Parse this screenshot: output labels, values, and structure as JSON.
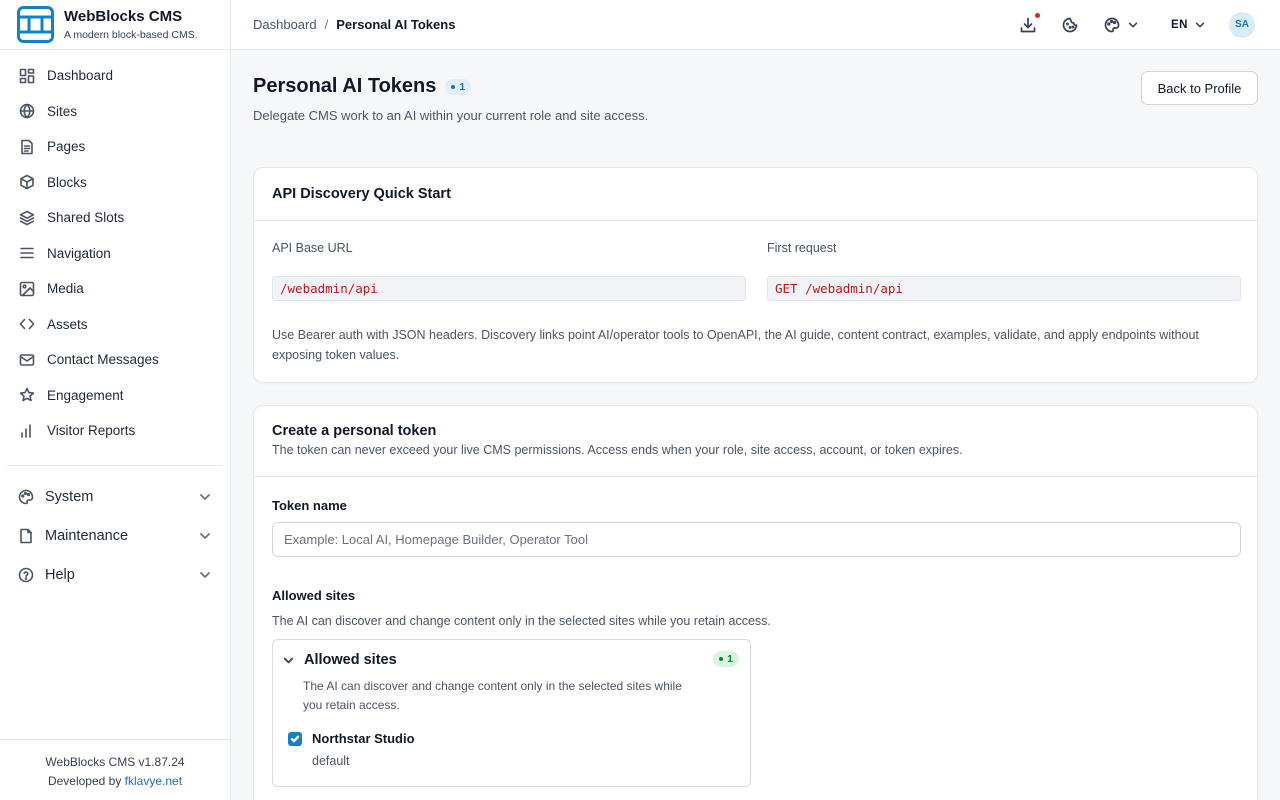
{
  "brand": {
    "name": "WebBlocks CMS",
    "tagline": "A modern block-based CMS."
  },
  "sidebar": {
    "items": [
      {
        "label": "Dashboard",
        "icon": "dashboard-icon"
      },
      {
        "label": "Sites",
        "icon": "globe-icon"
      },
      {
        "label": "Pages",
        "icon": "file-icon"
      },
      {
        "label": "Blocks",
        "icon": "cube-icon"
      },
      {
        "label": "Shared Slots",
        "icon": "layers-icon"
      },
      {
        "label": "Navigation",
        "icon": "menu-icon"
      },
      {
        "label": "Media",
        "icon": "image-icon"
      },
      {
        "label": "Assets",
        "icon": "code-icon"
      },
      {
        "label": "Contact Messages",
        "icon": "mail-icon"
      },
      {
        "label": "Engagement",
        "icon": "star-icon"
      },
      {
        "label": "Visitor Reports",
        "icon": "bar-chart-icon"
      }
    ],
    "groups": [
      {
        "label": "System",
        "icon": "palette-icon"
      },
      {
        "label": "Maintenance",
        "icon": "document-icon"
      },
      {
        "label": "Help",
        "icon": "help-circle-icon"
      }
    ],
    "footer": {
      "version": "WebBlocks CMS v1.87.24",
      "developed_by": "Developed by",
      "link": "fklavye.net"
    }
  },
  "topbar": {
    "breadcrumb_root": "Dashboard",
    "breadcrumb_separator": "/",
    "breadcrumb_current": "Personal AI Tokens",
    "language": "EN",
    "avatar_initials": "SA"
  },
  "header": {
    "title": "Personal AI Tokens",
    "count": "1",
    "subtitle": "Delegate CMS work to an AI within your current role and site access.",
    "back_button": "Back to Profile"
  },
  "discovery": {
    "title": "API Discovery Quick Start",
    "base_url_label": "API Base URL",
    "base_url_value": "/webadmin/api",
    "first_request_label": "First request",
    "first_request_value": "GET /webadmin/api",
    "note": "Use Bearer auth with JSON headers. Discovery links point AI/operator tools to OpenAPI, the AI guide, content contract, examples, validate, and apply endpoints without exposing token values."
  },
  "create_token": {
    "title": "Create a personal token",
    "subtitle": "The token can never exceed your live CMS permissions. Access ends when your role, site access, account, or token expires.",
    "name_label": "Token name",
    "name_placeholder": "Example: Local AI, Homepage Builder, Operator Tool",
    "name_value": "",
    "sites_label": "Allowed sites",
    "sites_help": "The AI can discover and change content only in the selected sites while you retain access.",
    "sites_panel": {
      "title": "Allowed sites",
      "count": "1",
      "description": "The AI can discover and change content only in the selected sites while you retain access.",
      "sites": [
        {
          "name": "Northstar Studio",
          "slug": "default",
          "checked": true
        }
      ]
    }
  },
  "colors": {
    "accent": "#1681c2",
    "link": "#1d6fb8",
    "code": "#b91c1c",
    "success": "#15803d"
  }
}
